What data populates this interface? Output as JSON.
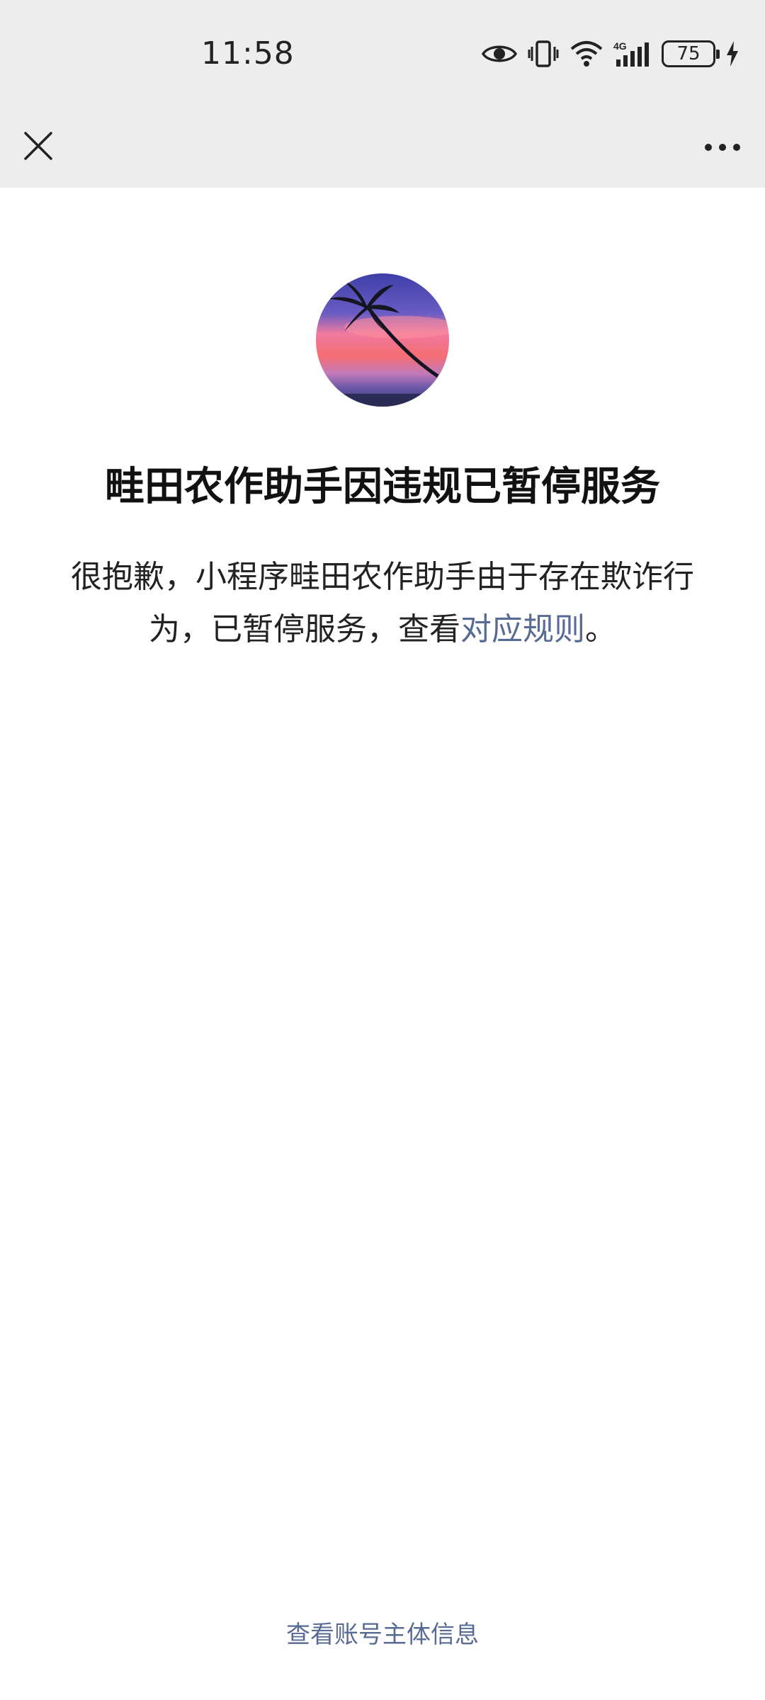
{
  "status_bar": {
    "time": "11:58",
    "battery_level": "75",
    "network": "4G",
    "icons": [
      "eye-icon",
      "vibrate-icon",
      "wifi-icon",
      "signal-icon",
      "battery-icon",
      "charging-icon"
    ]
  },
  "nav": {
    "close_icon": "close-icon",
    "more_icon": "more-icon"
  },
  "notice": {
    "title": "畦田农作助手因违规已暂停服务",
    "desc_before": "很抱歉，小程序畦田农作助手由于存在欺诈行为，已暂停服务，查看",
    "desc_link": "对应规则",
    "desc_after": "。",
    "link_color": "#576b95"
  },
  "footer": {
    "account_info_link": "查看账号主体信息"
  }
}
